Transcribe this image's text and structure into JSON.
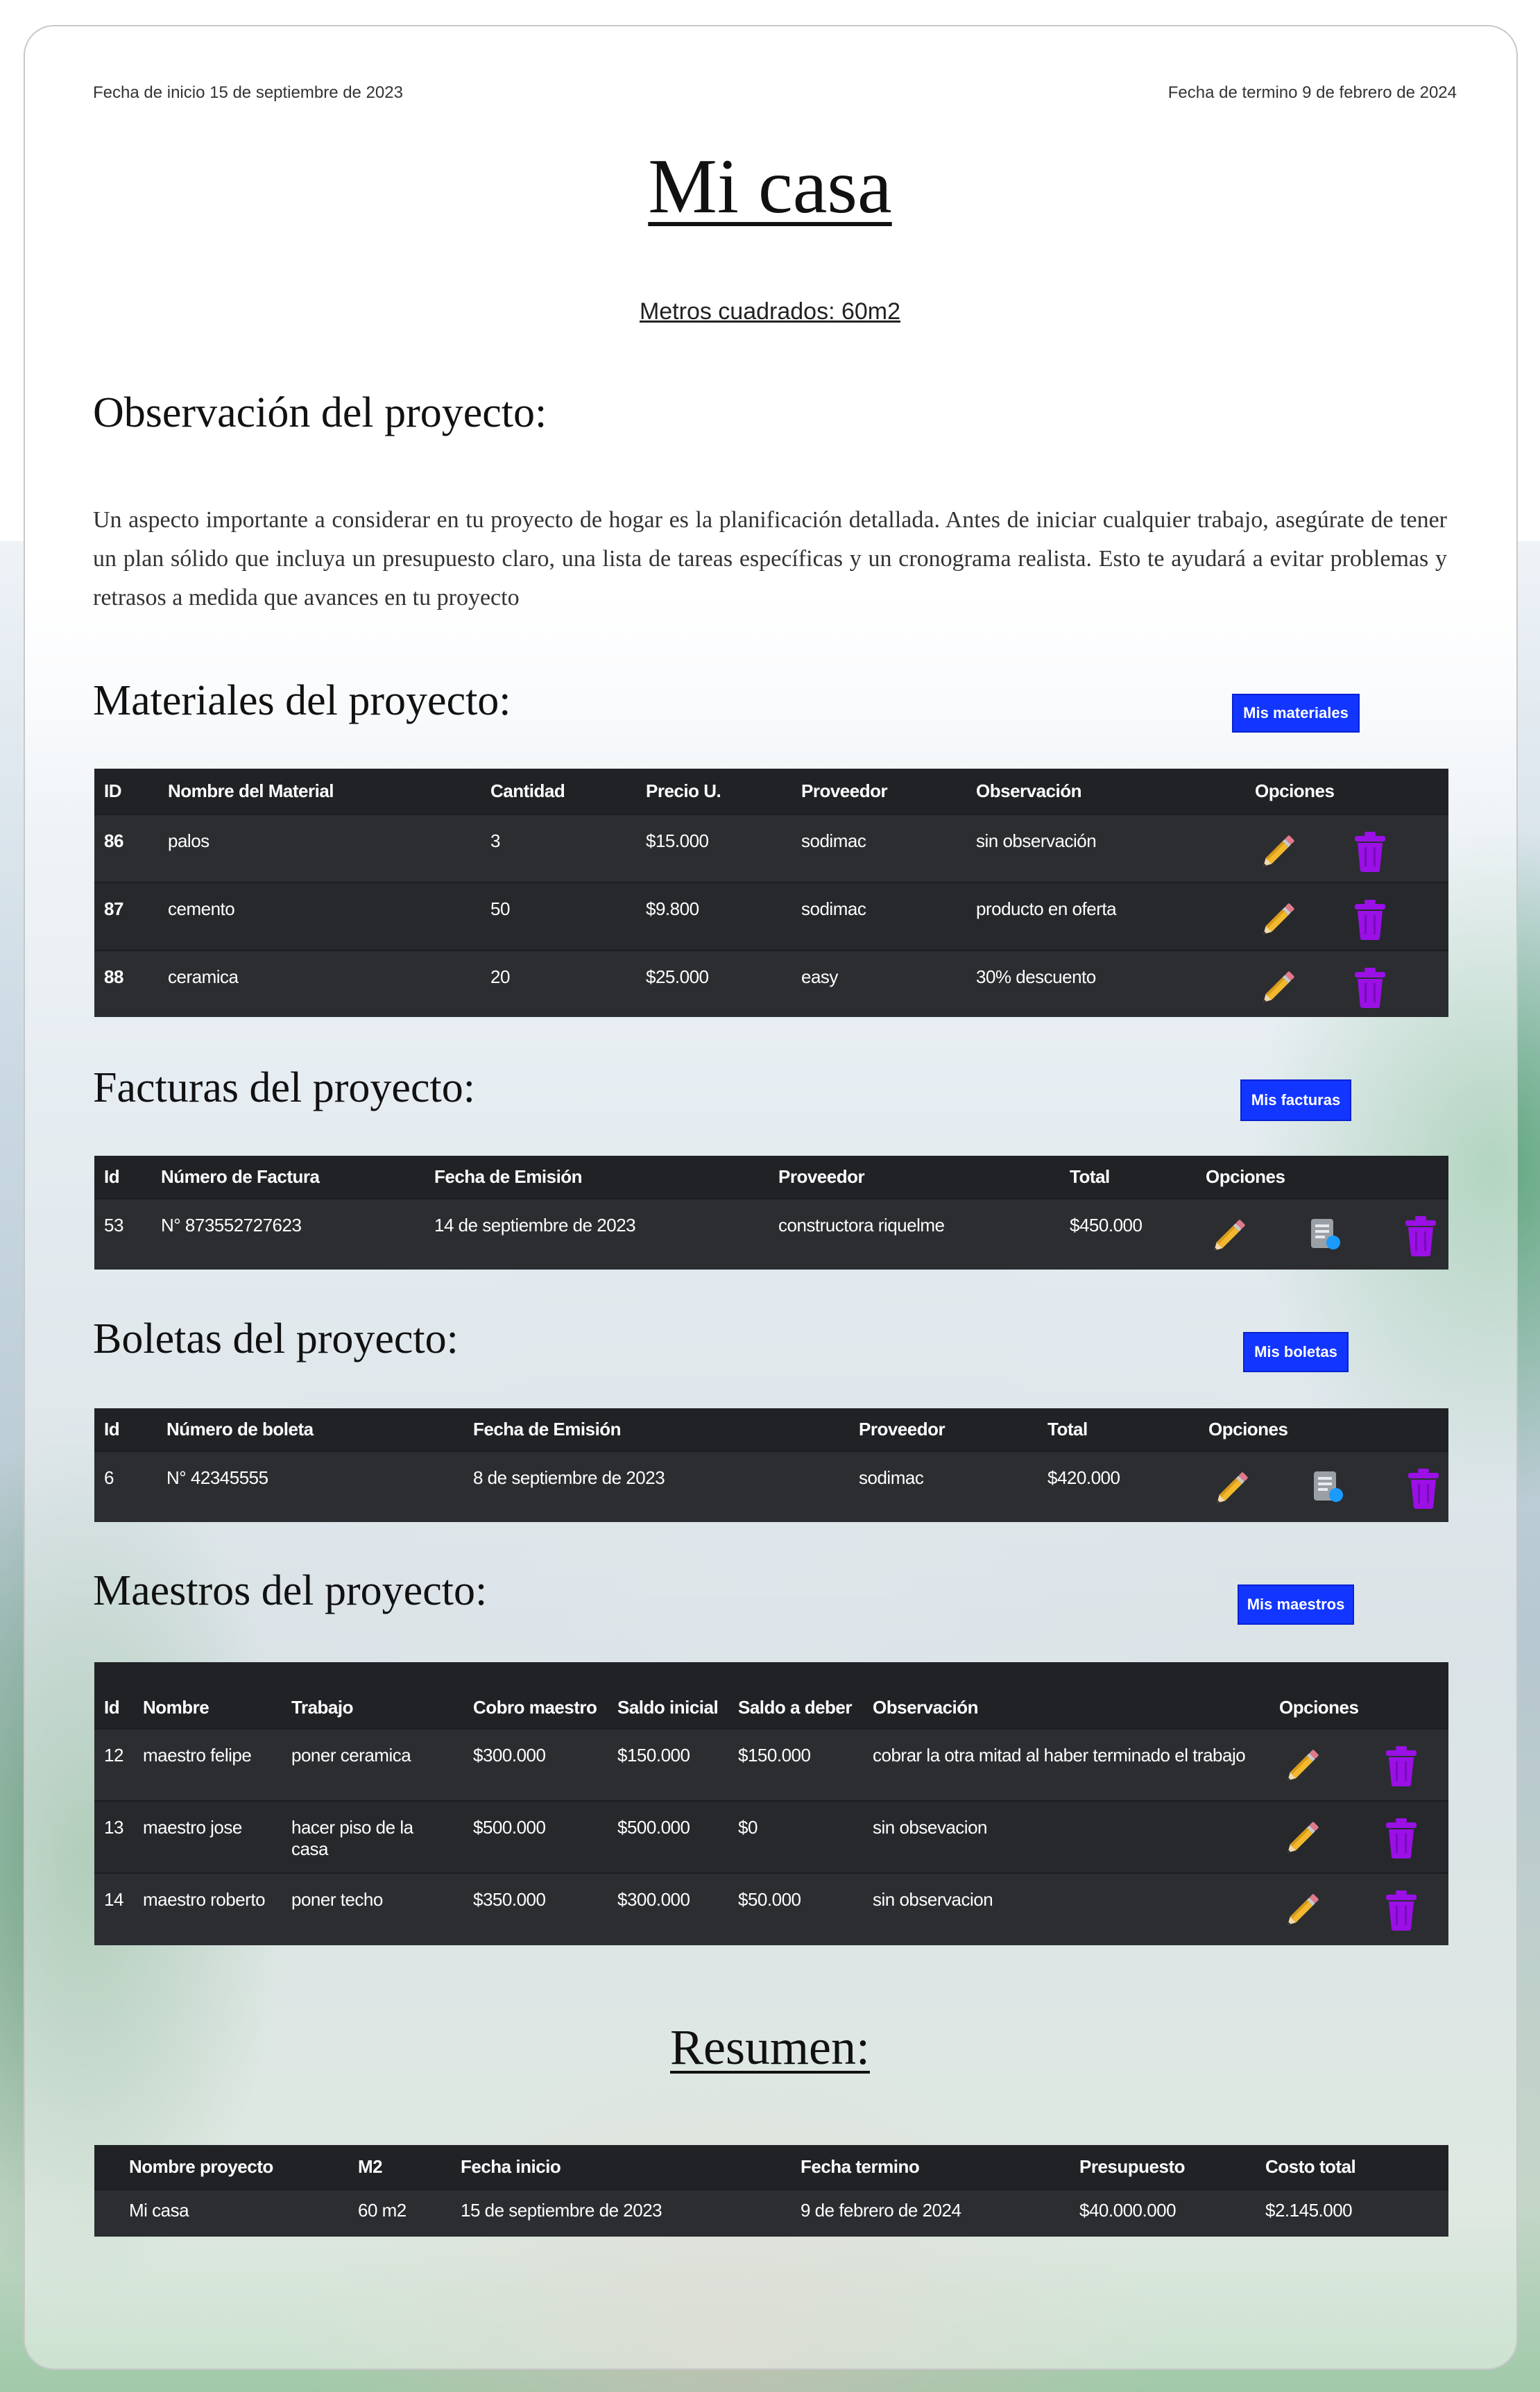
{
  "header": {
    "start_date": "Fecha de inicio 15 de septiembre de 2023",
    "end_date": "Fecha de termino 9 de febrero de 2024",
    "title": "Mi casa",
    "square_meters": "Metros cuadrados: 60m2"
  },
  "observation": {
    "heading": "Observación del proyecto:",
    "text": "Un aspecto importante a considerar en tu proyecto de hogar es la planificación detallada. Antes de iniciar cualquier trabajo, asegúrate de tener un plan sólido que incluya un presupuesto claro, una lista de tareas específicas y un cronograma realista. Esto te ayudará a evitar problemas y retrasos a medida que avances en tu proyecto"
  },
  "materials": {
    "heading": "Materiales del proyecto:",
    "button": "Mis materiales",
    "columns": [
      "ID",
      "Nombre del Material",
      "Cantidad",
      "Precio U.",
      "Proveedor",
      "Observación",
      "Opciones"
    ],
    "rows": [
      {
        "id": "86",
        "name": "palos",
        "qty": "3",
        "price": "$15.000",
        "provider": "sodimac",
        "obs": "sin observación"
      },
      {
        "id": "87",
        "name": "cemento",
        "qty": "50",
        "price": "$9.800",
        "provider": "sodimac",
        "obs": "producto en oferta"
      },
      {
        "id": "88",
        "name": "ceramica",
        "qty": "20",
        "price": "$25.000",
        "provider": "easy",
        "obs": "30% descuento"
      }
    ]
  },
  "invoices": {
    "heading": "Facturas del proyecto:",
    "button": "Mis facturas",
    "columns": [
      "Id",
      "Número de Factura",
      "Fecha de Emisión",
      "Proveedor",
      "Total",
      "Opciones"
    ],
    "rows": [
      {
        "id": "53",
        "number": "N° 873552727623",
        "date": "14 de septiembre de 2023",
        "provider": "constructora riquelme",
        "total": "$450.000"
      }
    ]
  },
  "receipts": {
    "heading": "Boletas del proyecto:",
    "button": "Mis boletas",
    "columns": [
      "Id",
      "Número de boleta",
      "Fecha de Emisión",
      "Proveedor",
      "Total",
      "Opciones"
    ],
    "rows": [
      {
        "id": "6",
        "number": "N° 42345555",
        "date": "8 de septiembre de 2023",
        "provider": "sodimac",
        "total": "$420.000"
      }
    ]
  },
  "masters": {
    "heading": "Maestros del proyecto:",
    "button": "Mis maestros",
    "columns": [
      "Id",
      "Nombre",
      "Trabajo",
      "Cobro maestro",
      "Saldo inicial",
      "Saldo a deber",
      "Observación",
      "Opciones"
    ],
    "rows": [
      {
        "id": "12",
        "name": "maestro felipe",
        "job": "poner ceramica",
        "charge": "$300.000",
        "initial": "$150.000",
        "owed": "$150.000",
        "obs": "cobrar la otra mitad al haber terminado el trabajo"
      },
      {
        "id": "13",
        "name": "maestro jose",
        "job": "hacer piso de la casa",
        "charge": "$500.000",
        "initial": "$500.000",
        "owed": "$0",
        "obs": "sin obsevacion"
      },
      {
        "id": "14",
        "name": "maestro roberto",
        "job": "poner techo",
        "charge": "$350.000",
        "initial": "$300.000",
        "owed": "$50.000",
        "obs": "sin observacion"
      }
    ]
  },
  "summary": {
    "heading": "Resumen:",
    "columns": [
      "Nombre proyecto",
      "M2",
      "Fecha inicio",
      "Fecha termino",
      "Presupuesto",
      "Costo total"
    ],
    "row": {
      "name": "Mi casa",
      "m2": "60 m2",
      "start": "15 de septiembre de 2023",
      "end": "9 de febrero de 2024",
      "budget": "$40.000.000",
      "total": "$2.145.000"
    }
  },
  "icons": {
    "edit": "pencil-icon",
    "delete": "trash-icon",
    "view": "document-view-icon",
    "edit_color": "#f2b92f",
    "delete_color": "#9a10e6",
    "button_color": "#1236ff"
  }
}
